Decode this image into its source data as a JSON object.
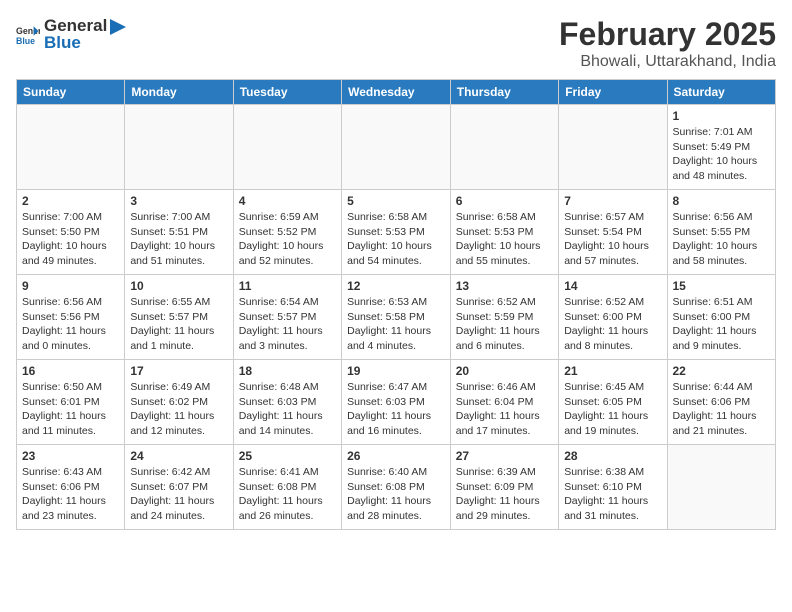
{
  "header": {
    "logo_general": "General",
    "logo_blue": "Blue",
    "title": "February 2025",
    "location": "Bhowali, Uttarakhand, India"
  },
  "weekdays": [
    "Sunday",
    "Monday",
    "Tuesday",
    "Wednesday",
    "Thursday",
    "Friday",
    "Saturday"
  ],
  "weeks": [
    [
      {
        "day": "",
        "info": ""
      },
      {
        "day": "",
        "info": ""
      },
      {
        "day": "",
        "info": ""
      },
      {
        "day": "",
        "info": ""
      },
      {
        "day": "",
        "info": ""
      },
      {
        "day": "",
        "info": ""
      },
      {
        "day": "1",
        "info": "Sunrise: 7:01 AM\nSunset: 5:49 PM\nDaylight: 10 hours and 48 minutes."
      }
    ],
    [
      {
        "day": "2",
        "info": "Sunrise: 7:00 AM\nSunset: 5:50 PM\nDaylight: 10 hours and 49 minutes."
      },
      {
        "day": "3",
        "info": "Sunrise: 7:00 AM\nSunset: 5:51 PM\nDaylight: 10 hours and 51 minutes."
      },
      {
        "day": "4",
        "info": "Sunrise: 6:59 AM\nSunset: 5:52 PM\nDaylight: 10 hours and 52 minutes."
      },
      {
        "day": "5",
        "info": "Sunrise: 6:58 AM\nSunset: 5:53 PM\nDaylight: 10 hours and 54 minutes."
      },
      {
        "day": "6",
        "info": "Sunrise: 6:58 AM\nSunset: 5:53 PM\nDaylight: 10 hours and 55 minutes."
      },
      {
        "day": "7",
        "info": "Sunrise: 6:57 AM\nSunset: 5:54 PM\nDaylight: 10 hours and 57 minutes."
      },
      {
        "day": "8",
        "info": "Sunrise: 6:56 AM\nSunset: 5:55 PM\nDaylight: 10 hours and 58 minutes."
      }
    ],
    [
      {
        "day": "9",
        "info": "Sunrise: 6:56 AM\nSunset: 5:56 PM\nDaylight: 11 hours and 0 minutes."
      },
      {
        "day": "10",
        "info": "Sunrise: 6:55 AM\nSunset: 5:57 PM\nDaylight: 11 hours and 1 minute."
      },
      {
        "day": "11",
        "info": "Sunrise: 6:54 AM\nSunset: 5:57 PM\nDaylight: 11 hours and 3 minutes."
      },
      {
        "day": "12",
        "info": "Sunrise: 6:53 AM\nSunset: 5:58 PM\nDaylight: 11 hours and 4 minutes."
      },
      {
        "day": "13",
        "info": "Sunrise: 6:52 AM\nSunset: 5:59 PM\nDaylight: 11 hours and 6 minutes."
      },
      {
        "day": "14",
        "info": "Sunrise: 6:52 AM\nSunset: 6:00 PM\nDaylight: 11 hours and 8 minutes."
      },
      {
        "day": "15",
        "info": "Sunrise: 6:51 AM\nSunset: 6:00 PM\nDaylight: 11 hours and 9 minutes."
      }
    ],
    [
      {
        "day": "16",
        "info": "Sunrise: 6:50 AM\nSunset: 6:01 PM\nDaylight: 11 hours and 11 minutes."
      },
      {
        "day": "17",
        "info": "Sunrise: 6:49 AM\nSunset: 6:02 PM\nDaylight: 11 hours and 12 minutes."
      },
      {
        "day": "18",
        "info": "Sunrise: 6:48 AM\nSunset: 6:03 PM\nDaylight: 11 hours and 14 minutes."
      },
      {
        "day": "19",
        "info": "Sunrise: 6:47 AM\nSunset: 6:03 PM\nDaylight: 11 hours and 16 minutes."
      },
      {
        "day": "20",
        "info": "Sunrise: 6:46 AM\nSunset: 6:04 PM\nDaylight: 11 hours and 17 minutes."
      },
      {
        "day": "21",
        "info": "Sunrise: 6:45 AM\nSunset: 6:05 PM\nDaylight: 11 hours and 19 minutes."
      },
      {
        "day": "22",
        "info": "Sunrise: 6:44 AM\nSunset: 6:06 PM\nDaylight: 11 hours and 21 minutes."
      }
    ],
    [
      {
        "day": "23",
        "info": "Sunrise: 6:43 AM\nSunset: 6:06 PM\nDaylight: 11 hours and 23 minutes."
      },
      {
        "day": "24",
        "info": "Sunrise: 6:42 AM\nSunset: 6:07 PM\nDaylight: 11 hours and 24 minutes."
      },
      {
        "day": "25",
        "info": "Sunrise: 6:41 AM\nSunset: 6:08 PM\nDaylight: 11 hours and 26 minutes."
      },
      {
        "day": "26",
        "info": "Sunrise: 6:40 AM\nSunset: 6:08 PM\nDaylight: 11 hours and 28 minutes."
      },
      {
        "day": "27",
        "info": "Sunrise: 6:39 AM\nSunset: 6:09 PM\nDaylight: 11 hours and 29 minutes."
      },
      {
        "day": "28",
        "info": "Sunrise: 6:38 AM\nSunset: 6:10 PM\nDaylight: 11 hours and 31 minutes."
      },
      {
        "day": "",
        "info": ""
      }
    ]
  ]
}
